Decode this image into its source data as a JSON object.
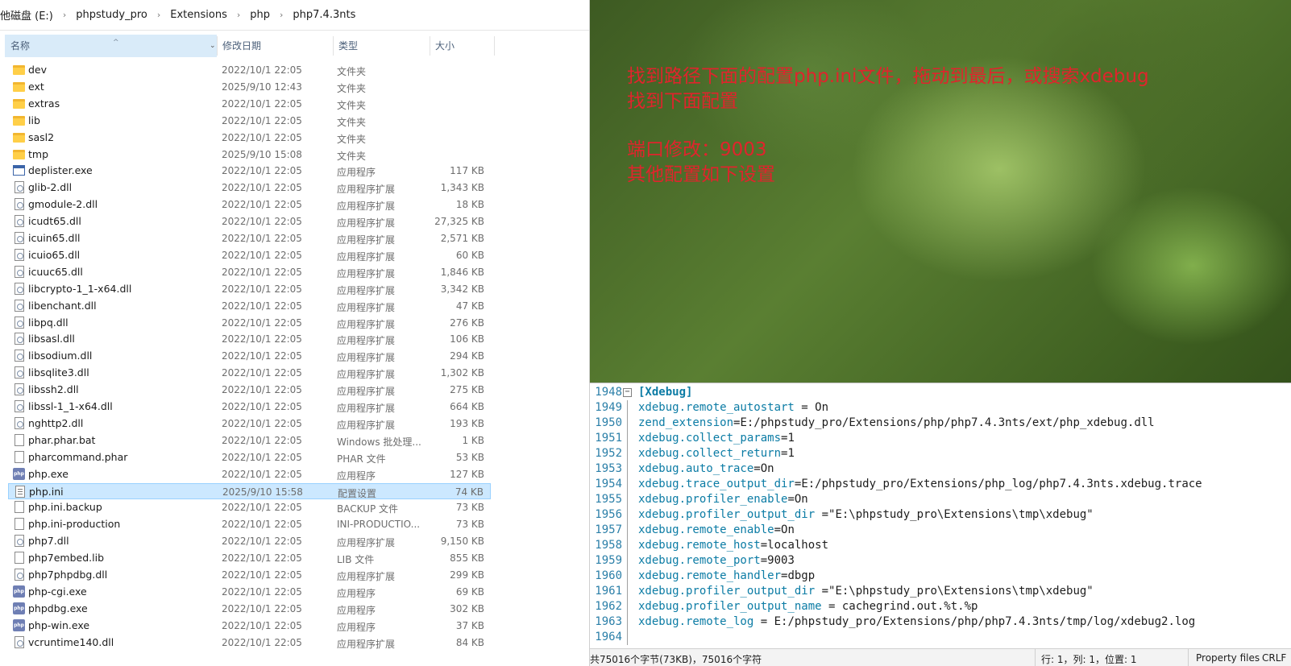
{
  "address": [
    "他磁盘 (E:)",
    "phpstudy_pro",
    "Extensions",
    "php",
    "php7.4.3nts"
  ],
  "columns": {
    "name": "名称",
    "date": "修改日期",
    "type": "类型",
    "size": "大小"
  },
  "files": [
    {
      "name": "dev",
      "date": "2022/10/1 22:05",
      "type": "文件夹",
      "size": "",
      "icon": "folder-icon"
    },
    {
      "name": "ext",
      "date": "2025/9/10 12:43",
      "type": "文件夹",
      "size": "",
      "icon": "folder-icon"
    },
    {
      "name": "extras",
      "date": "2022/10/1 22:05",
      "type": "文件夹",
      "size": "",
      "icon": "folder-icon"
    },
    {
      "name": "lib",
      "date": "2022/10/1 22:05",
      "type": "文件夹",
      "size": "",
      "icon": "folder-icon"
    },
    {
      "name": "sasl2",
      "date": "2022/10/1 22:05",
      "type": "文件夹",
      "size": "",
      "icon": "folder-icon"
    },
    {
      "name": "tmp",
      "date": "2025/9/10 15:08",
      "type": "文件夹",
      "size": "",
      "icon": "folder-icon"
    },
    {
      "name": "deplister.exe",
      "date": "2022/10/1 22:05",
      "type": "应用程序",
      "size": "117 KB",
      "icon": "exe-icon"
    },
    {
      "name": "glib-2.dll",
      "date": "2022/10/1 22:05",
      "type": "应用程序扩展",
      "size": "1,343 KB",
      "icon": "dll-icon"
    },
    {
      "name": "gmodule-2.dll",
      "date": "2022/10/1 22:05",
      "type": "应用程序扩展",
      "size": "18 KB",
      "icon": "dll-icon"
    },
    {
      "name": "icudt65.dll",
      "date": "2022/10/1 22:05",
      "type": "应用程序扩展",
      "size": "27,325 KB",
      "icon": "dll-icon"
    },
    {
      "name": "icuin65.dll",
      "date": "2022/10/1 22:05",
      "type": "应用程序扩展",
      "size": "2,571 KB",
      "icon": "dll-icon"
    },
    {
      "name": "icuio65.dll",
      "date": "2022/10/1 22:05",
      "type": "应用程序扩展",
      "size": "60 KB",
      "icon": "dll-icon"
    },
    {
      "name": "icuuc65.dll",
      "date": "2022/10/1 22:05",
      "type": "应用程序扩展",
      "size": "1,846 KB",
      "icon": "dll-icon"
    },
    {
      "name": "libcrypto-1_1-x64.dll",
      "date": "2022/10/1 22:05",
      "type": "应用程序扩展",
      "size": "3,342 KB",
      "icon": "dll-icon"
    },
    {
      "name": "libenchant.dll",
      "date": "2022/10/1 22:05",
      "type": "应用程序扩展",
      "size": "47 KB",
      "icon": "dll-icon"
    },
    {
      "name": "libpq.dll",
      "date": "2022/10/1 22:05",
      "type": "应用程序扩展",
      "size": "276 KB",
      "icon": "dll-icon"
    },
    {
      "name": "libsasl.dll",
      "date": "2022/10/1 22:05",
      "type": "应用程序扩展",
      "size": "106 KB",
      "icon": "dll-icon"
    },
    {
      "name": "libsodium.dll",
      "date": "2022/10/1 22:05",
      "type": "应用程序扩展",
      "size": "294 KB",
      "icon": "dll-icon"
    },
    {
      "name": "libsqlite3.dll",
      "date": "2022/10/1 22:05",
      "type": "应用程序扩展",
      "size": "1,302 KB",
      "icon": "dll-icon"
    },
    {
      "name": "libssh2.dll",
      "date": "2022/10/1 22:05",
      "type": "应用程序扩展",
      "size": "275 KB",
      "icon": "dll-icon"
    },
    {
      "name": "libssl-1_1-x64.dll",
      "date": "2022/10/1 22:05",
      "type": "应用程序扩展",
      "size": "664 KB",
      "icon": "dll-icon"
    },
    {
      "name": "nghttp2.dll",
      "date": "2022/10/1 22:05",
      "type": "应用程序扩展",
      "size": "193 KB",
      "icon": "dll-icon"
    },
    {
      "name": "phar.phar.bat",
      "date": "2022/10/1 22:05",
      "type": "Windows 批处理...",
      "size": "1 KB",
      "icon": "bat-icon"
    },
    {
      "name": "pharcommand.phar",
      "date": "2022/10/1 22:05",
      "type": "PHAR 文件",
      "size": "53 KB",
      "icon": "file-icon"
    },
    {
      "name": "php.exe",
      "date": "2022/10/1 22:05",
      "type": "应用程序",
      "size": "127 KB",
      "icon": "php-icon"
    },
    {
      "name": "php.ini",
      "date": "2025/9/10 15:58",
      "type": "配置设置",
      "size": "74 KB",
      "icon": "ini-icon",
      "selected": true
    },
    {
      "name": "php.ini.backup",
      "date": "2022/10/1 22:05",
      "type": "BACKUP 文件",
      "size": "73 KB",
      "icon": "file-icon"
    },
    {
      "name": "php.ini-production",
      "date": "2022/10/1 22:05",
      "type": "INI-PRODUCTIO...",
      "size": "73 KB",
      "icon": "file-icon"
    },
    {
      "name": "php7.dll",
      "date": "2022/10/1 22:05",
      "type": "应用程序扩展",
      "size": "9,150 KB",
      "icon": "dll-icon"
    },
    {
      "name": "php7embed.lib",
      "date": "2022/10/1 22:05",
      "type": "LIB 文件",
      "size": "855 KB",
      "icon": "file-icon"
    },
    {
      "name": "php7phpdbg.dll",
      "date": "2022/10/1 22:05",
      "type": "应用程序扩展",
      "size": "299 KB",
      "icon": "dll-icon"
    },
    {
      "name": "php-cgi.exe",
      "date": "2022/10/1 22:05",
      "type": "应用程序",
      "size": "69 KB",
      "icon": "php-icon"
    },
    {
      "name": "phpdbg.exe",
      "date": "2022/10/1 22:05",
      "type": "应用程序",
      "size": "302 KB",
      "icon": "php-icon"
    },
    {
      "name": "php-win.exe",
      "date": "2022/10/1 22:05",
      "type": "应用程序",
      "size": "37 KB",
      "icon": "php-icon"
    },
    {
      "name": "vcruntime140.dll",
      "date": "2022/10/1 22:05",
      "type": "应用程序扩展",
      "size": "84 KB",
      "icon": "dll-icon"
    }
  ],
  "annotation": {
    "line1": "找到路径下面的配置php.ini文件，拖动到最后，或搜索xdebug",
    "line2": "找到下面配置",
    "line3": "端口修改：9003",
    "line4": "其他配置如下设置"
  },
  "editor": {
    "lines": [
      {
        "num": "1948",
        "key": "[Xdebug]",
        "op": "",
        "value": "",
        "section": true
      },
      {
        "num": "1949",
        "key": "xdebug.remote_autostart",
        "op": " = ",
        "value": "On"
      },
      {
        "num": "1950",
        "key": "zend_extension",
        "op": "=",
        "value": "E:/phpstudy_pro/Extensions/php/php7.4.3nts/ext/php_xdebug.dll"
      },
      {
        "num": "1951",
        "key": "xdebug.collect_params",
        "op": "=",
        "value": "1"
      },
      {
        "num": "1952",
        "key": "xdebug.collect_return",
        "op": "=",
        "value": "1"
      },
      {
        "num": "1953",
        "key": "xdebug.auto_trace",
        "op": "=",
        "value": "On"
      },
      {
        "num": "1954",
        "key": "xdebug.trace_output_dir",
        "op": "=",
        "value": "E:/phpstudy_pro/Extensions/php_log/php7.4.3nts.xdebug.trace"
      },
      {
        "num": "1955",
        "key": "xdebug.profiler_enable",
        "op": "=",
        "value": "On"
      },
      {
        "num": "1956",
        "key": "xdebug.profiler_output_dir",
        "op": " =",
        "value": "\"E:\\phpstudy_pro\\Extensions\\tmp\\xdebug\""
      },
      {
        "num": "1957",
        "key": "xdebug.remote_enable",
        "op": "=",
        "value": "On"
      },
      {
        "num": "1958",
        "key": "xdebug.remote_host",
        "op": "=",
        "value": "localhost"
      },
      {
        "num": "1959",
        "key": "xdebug.remote_port",
        "op": "=",
        "value": "9003"
      },
      {
        "num": "1960",
        "key": "xdebug.remote_handler",
        "op": "=",
        "value": "dbgp"
      },
      {
        "num": "1961",
        "key": "xdebug.profiler_output_dir",
        "op": " =",
        "value": "\"E:\\phpstudy_pro\\Extensions\\tmp\\xdebug\""
      },
      {
        "num": "1962",
        "key": "xdebug.profiler_output_name",
        "op": " = ",
        "value": "cachegrind.out.%t.%p"
      },
      {
        "num": "1963",
        "key": "xdebug.remote_log",
        "op": " = ",
        "value": "E:/phpstudy_pro/Extensions/php/php7.4.3nts/tmp/log/xdebug2.log"
      },
      {
        "num": "1964",
        "key": "",
        "op": "",
        "value": ""
      }
    ],
    "status": {
      "size": "共75016个字节(73KB)，75016个字符",
      "position": "行: 1，列: 1，位置: 1",
      "properties": "Property files",
      "eol": "CRLF"
    }
  }
}
